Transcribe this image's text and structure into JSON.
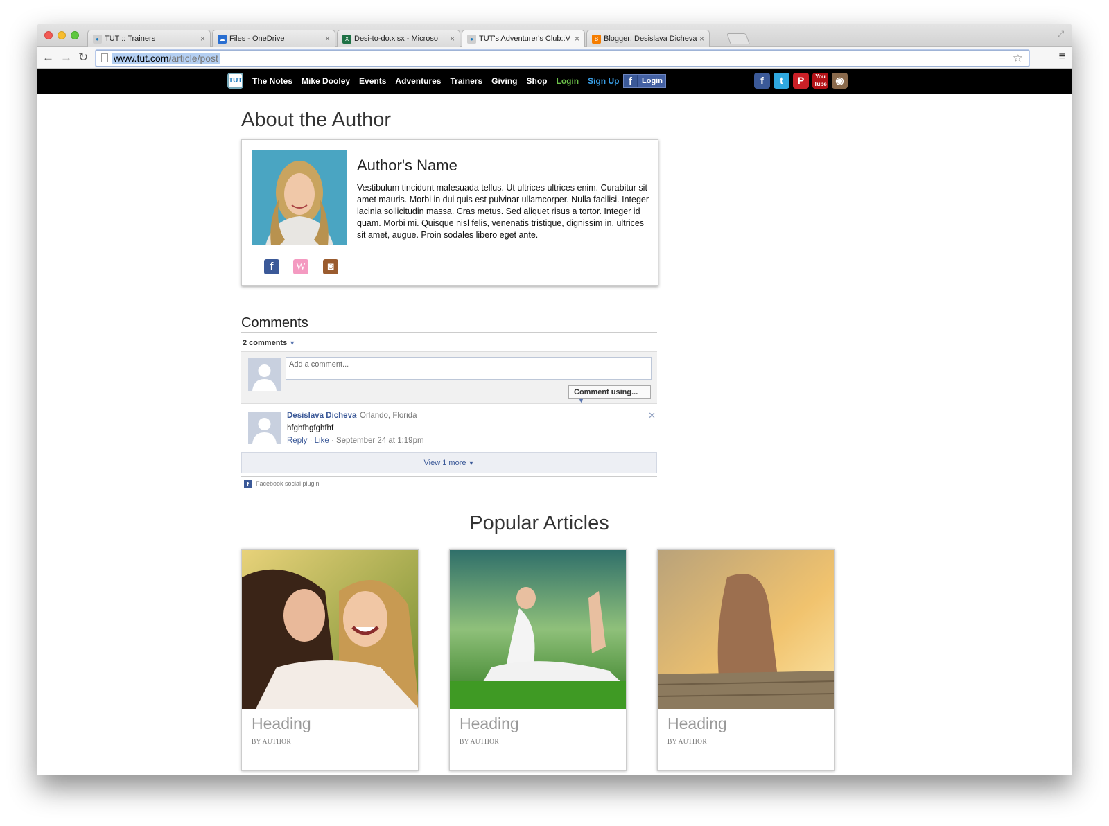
{
  "browser": {
    "tabs": [
      {
        "label": "TUT :: Trainers",
        "favicon_color": "#d8d8d8",
        "favicon_text": "tut"
      },
      {
        "label": "Files - OneDrive",
        "favicon_color": "#2a6fd1",
        "favicon_text": ""
      },
      {
        "label": "Desi-to-do.xlsx - Microso",
        "favicon_color": "#1e7145",
        "favicon_text": "X"
      },
      {
        "label": "TUT's Adventurer's Club::V",
        "favicon_color": "#d8d8d8",
        "favicon_text": "tut"
      },
      {
        "label": "Blogger: Desislava Dicheva",
        "favicon_color": "#f57d00",
        "favicon_text": "B"
      }
    ],
    "url_host": "www.tut.com",
    "url_path": "/article/post"
  },
  "sitenav": {
    "logo": "TUT",
    "items": [
      "The Notes",
      "Mike Dooley",
      "Events",
      "Adventures",
      "Trainers",
      "Giving",
      "Shop"
    ],
    "login": "Login",
    "signup": "Sign Up",
    "fb_login": "Login",
    "social": [
      {
        "name": "facebook-icon",
        "glyph": "f",
        "color": "#3b5998"
      },
      {
        "name": "twitter-icon",
        "glyph": "t",
        "color": "#2fa8e0"
      },
      {
        "name": "pinterest-icon",
        "glyph": "P",
        "color": "#cb2027"
      },
      {
        "name": "youtube-icon",
        "glyph": "You",
        "color": "#b31217"
      },
      {
        "name": "instagram-icon",
        "glyph": "◉",
        "color": "#8a6a4c"
      }
    ]
  },
  "about": {
    "title": "About the Author",
    "name": "Author's Name",
    "bio": "Vestibulum tincidunt malesuada tellus. Ut ultrices ultrices enim. Curabitur sit amet mauris. Morbi in dui quis est pulvinar ullamcorper. Nulla facilisi. Integer lacinia sollicitudin massa. Cras metus. Sed aliquet risus a tortor. Integer id quam. Morbi mi. Quisque nisl felis, venenatis tristique, dignissim in, ultrices sit amet, augue. Proin sodales libero eget ante.",
    "icons": [
      {
        "name": "facebook-icon",
        "glyph": "f",
        "color": "#3b5998"
      },
      {
        "name": "wordpress-icon",
        "glyph": "W",
        "color": "#f49ac1"
      },
      {
        "name": "instagram-icon",
        "glyph": "◙",
        "color": "#9a5b2e"
      }
    ]
  },
  "comments": {
    "title": "Comments",
    "count": "2 comments",
    "placeholder": "Add a comment...",
    "comment_using": "Comment using...",
    "items": [
      {
        "author": "Desislava Dicheva",
        "location": "· Orlando, Florida",
        "text": "hfghfhgfghfhf",
        "reply": "Reply",
        "like": "Like",
        "date": "· September 24 at 1:19pm"
      }
    ],
    "view_more": "View 1 more",
    "plugin": "Facebook social plugin"
  },
  "popular": {
    "title": "Popular Articles",
    "cards": [
      {
        "heading": "Heading",
        "author": "BY AUTHOR"
      },
      {
        "heading": "Heading",
        "author": "BY AUTHOR"
      },
      {
        "heading": "Heading",
        "author": "BY AUTHOR"
      }
    ]
  }
}
